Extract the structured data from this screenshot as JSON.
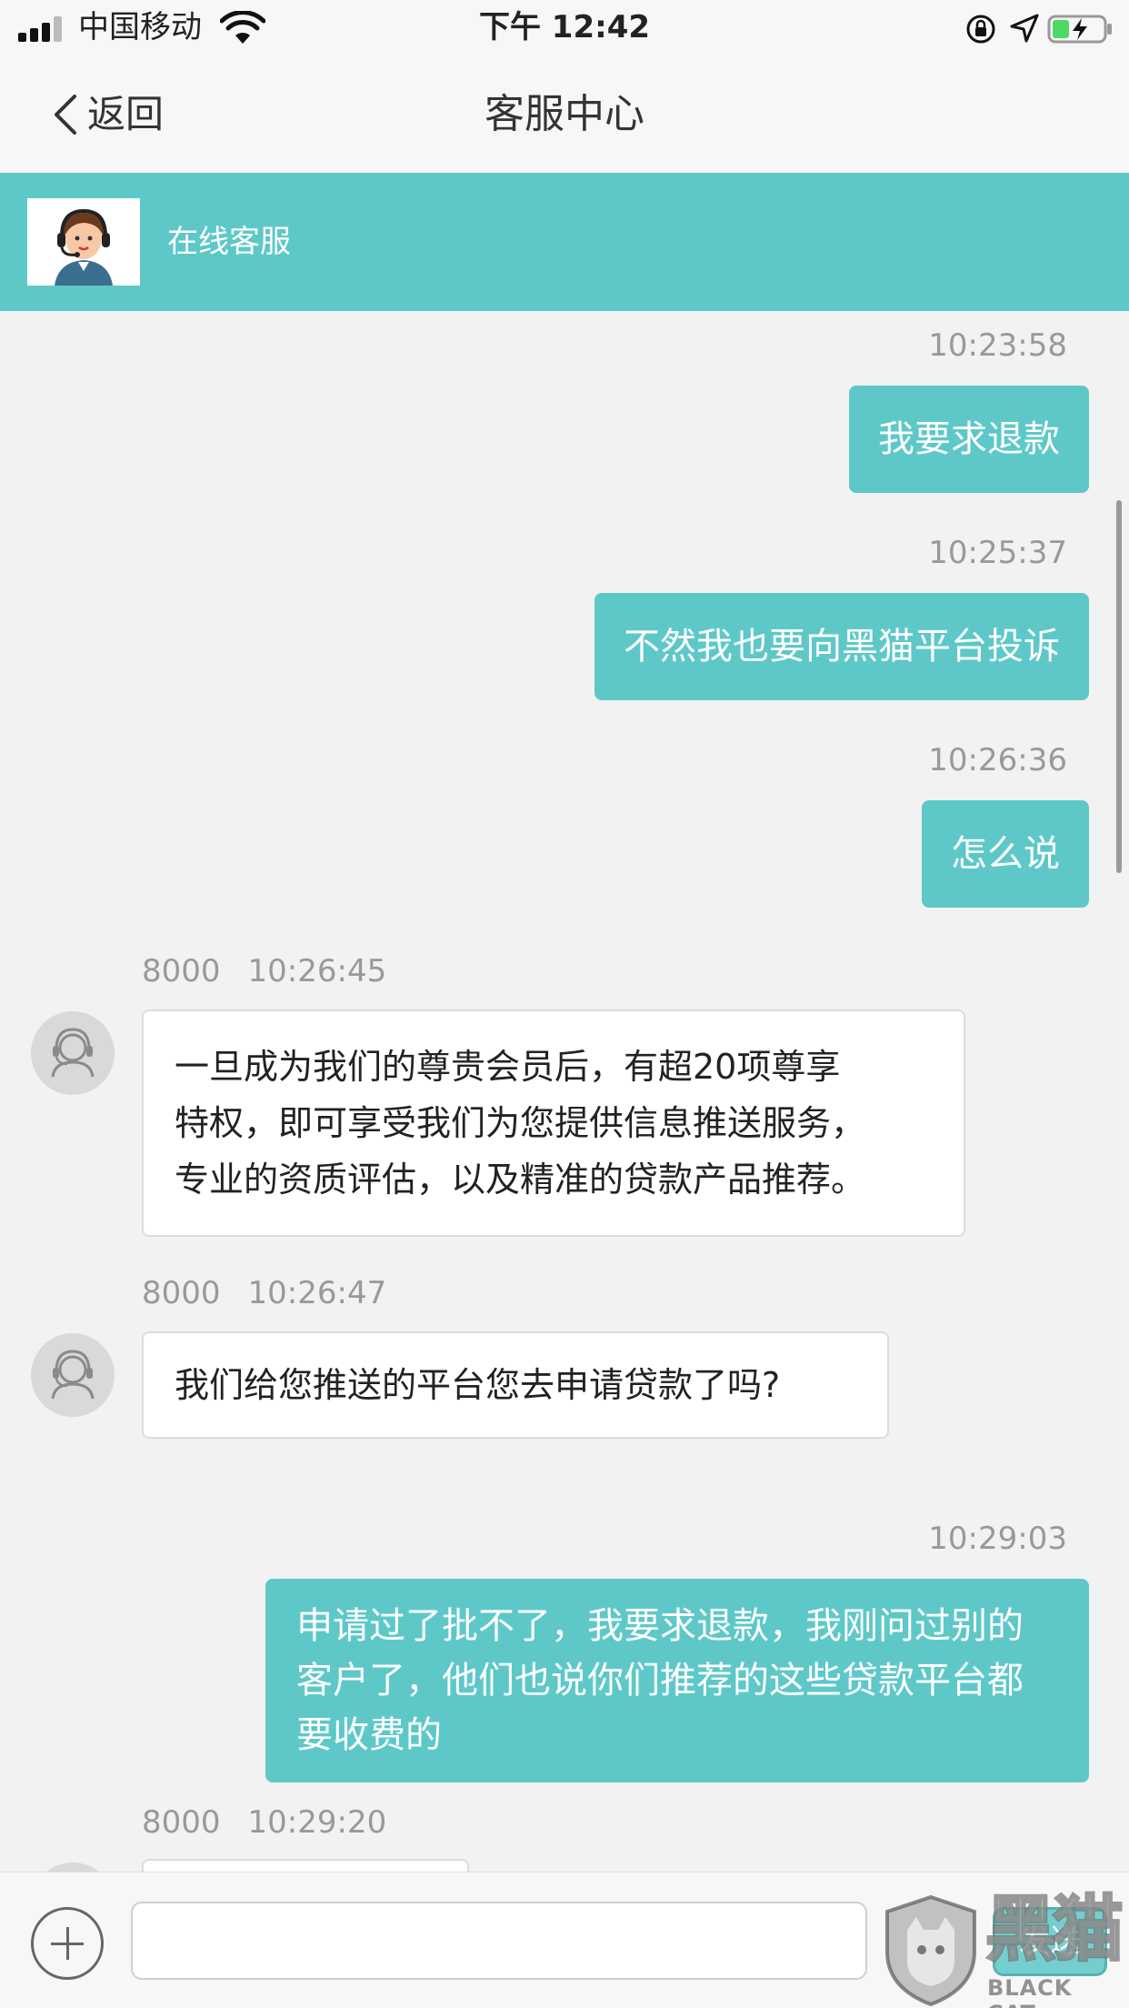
{
  "status_bar": {
    "carrier": "中国移动",
    "time": "下午 12:42"
  },
  "nav": {
    "back_label": "返回",
    "title": "客服中心"
  },
  "agent": {
    "name": "在线客服"
  },
  "messages": [
    {
      "side": "me",
      "time": "10:23:58",
      "text": "我要求退款"
    },
    {
      "side": "me",
      "time": "10:25:37",
      "text": "不然我也要向黑猫平台投诉"
    },
    {
      "side": "me",
      "time": "10:26:36",
      "text": "怎么说"
    },
    {
      "side": "other",
      "sender": "8000",
      "time": "10:26:45",
      "lines": [
        "一旦成为我们的尊贵会员后，有超20项尊享",
        "特权，即可享受我们为您提供信息推送服务，",
        "专业的资质评估，以及精准的贷款产品推荐。"
      ]
    },
    {
      "side": "other",
      "sender": "8000",
      "time": "10:26:47",
      "text": "我们给您推送的平台您去申请贷款了吗?"
    },
    {
      "side": "me",
      "time": "10:29:03",
      "lines": [
        "申请过了批不了，我要求退款，我刚问过别的",
        "客户了，他们也说你们推荐的这些贷款平台都",
        "要收费的"
      ]
    },
    {
      "side": "other",
      "sender": "8000",
      "time": "10:29:20",
      "text": ""
    }
  ],
  "input": {
    "placeholder": "",
    "send_label": "发送"
  },
  "watermark": {
    "cn": "黑猫",
    "en": "BLACK CAT"
  },
  "colors": {
    "accent": "#5ec8c8",
    "background": "#f2f2f2",
    "bar": "#f7f7f7"
  },
  "icons": {
    "plus": "plus-circle-icon",
    "back": "chevron-left-icon",
    "agent_avatar": "support-agent-icon",
    "service_avatar": "headset-user-icon"
  }
}
